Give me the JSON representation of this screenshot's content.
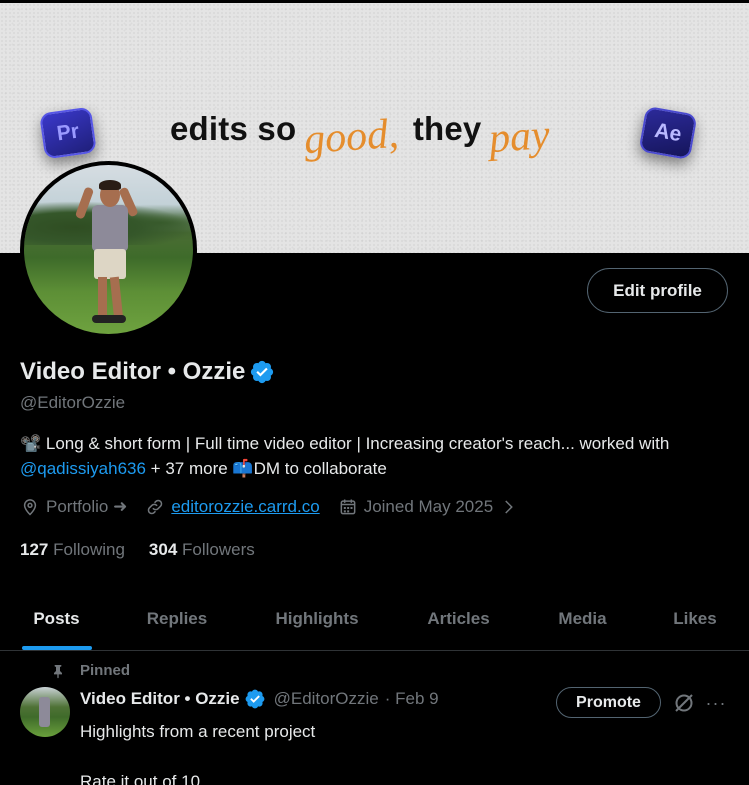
{
  "banner": {
    "text_bold_1": "edits so",
    "text_script_1": "good,",
    "text_bold_2": "they",
    "text_script_2": "pay",
    "left_icon_label": "Pr",
    "right_icon_label": "Ae"
  },
  "profile": {
    "edit_profile_label": "Edit profile",
    "display_name": "Video Editor • Ozzie",
    "handle": "@EditorOzzie",
    "bio_prefix": "📽️ Long & short form | Full time video editor | Increasing creator's reach... worked with ",
    "bio_mention": "@qadissiyah636",
    "bio_suffix": " + 37 more 📫DM to collaborate",
    "portfolio_label": "Portfolio ➜",
    "website": "editorozzie.carrd.co",
    "joined": "Joined May 2025",
    "following_count": "127",
    "following_label": "Following",
    "followers_count": "304",
    "followers_label": "Followers"
  },
  "tabs": [
    {
      "label": "Posts",
      "active": true
    },
    {
      "label": "Replies"
    },
    {
      "label": "Highlights"
    },
    {
      "label": "Articles"
    },
    {
      "label": "Media"
    },
    {
      "label": "Likes"
    }
  ],
  "pinned_post": {
    "pinned_label": "Pinned",
    "author_name": "Video Editor • Ozzie",
    "author_handle": "@EditorOzzie",
    "date": "· Feb 9",
    "promote_label": "Promote",
    "more_label": "···",
    "text_line_1": "Highlights from a recent project",
    "text_line_2": "",
    "text_line_3": "Rate it out of 10"
  },
  "colors": {
    "accent": "#1d9bf0",
    "background": "#000000",
    "muted": "#71767b",
    "text": "#e7e9ea",
    "banner_script": "#e58d2d"
  },
  "icons": [
    "location-icon",
    "link-icon",
    "calendar-icon",
    "chevron-right-icon",
    "verified-icon",
    "pin-icon",
    "grok-icon",
    "more-icon"
  ]
}
